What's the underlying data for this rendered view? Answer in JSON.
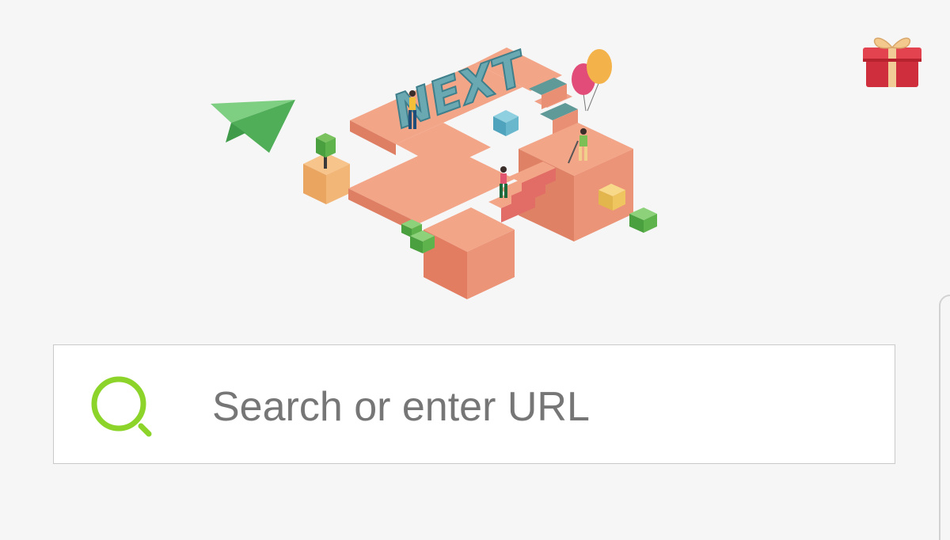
{
  "banner": {
    "sign_text": "NEXT",
    "illustration_icon": "isometric-next-illustration",
    "colors": {
      "platform": "#ec9a7c",
      "platform_side": "#d9765c",
      "cube_green": "#5bb44e",
      "cube_teal": "#5fb2c9",
      "cube_yellow": "#f2c66a",
      "paper_plane": "#54b861"
    }
  },
  "gift": {
    "icon": "gift-box-icon",
    "color": "#d93545"
  },
  "search": {
    "placeholder": "Search or enter URL",
    "icon": "search-icon",
    "accent": "#8cd42a"
  }
}
